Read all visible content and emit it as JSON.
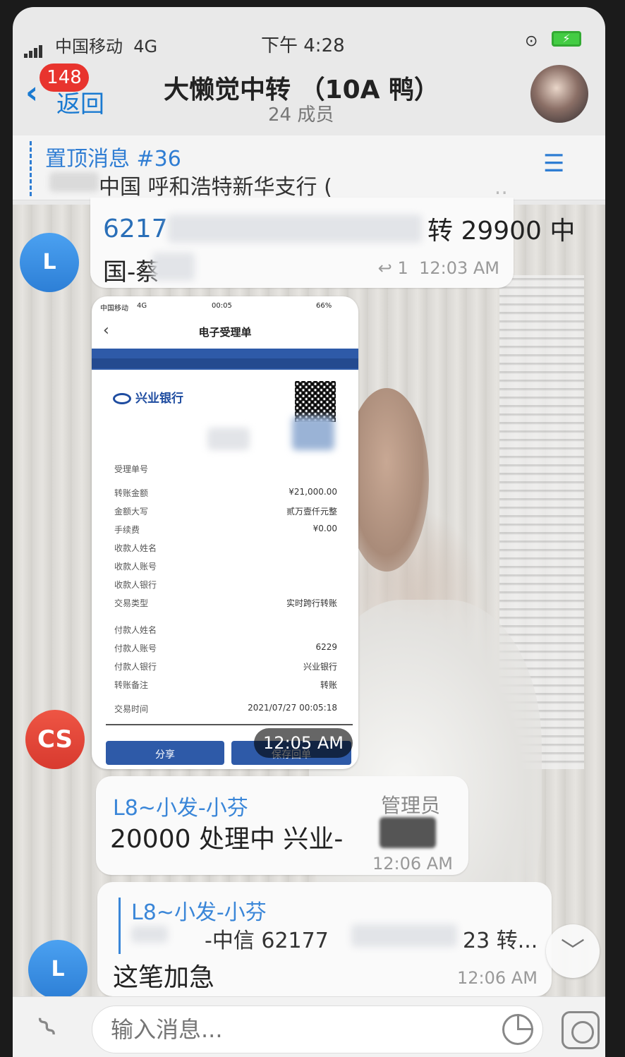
{
  "status_bar": {
    "carrier": "中国移动",
    "network": "4G",
    "time": "下午 4:28"
  },
  "header": {
    "unread_badge": "148",
    "back_label": "返回",
    "title": "大懒觉中转 （10A 鸭）",
    "members": "24 成员"
  },
  "pinned": {
    "title": "置顶消息 #36",
    "text": "中国 呼和浩特新华支行 (",
    "ellipsis": ".."
  },
  "messages": [
    {
      "avatar": "L",
      "line1": "6217",
      "line1_right": "转 29900 中",
      "line2": "国-蔡",
      "reply_count": "1",
      "time": "12:03 AM"
    },
    {
      "avatar": "CS",
      "time": "12:05 AM",
      "receipt": {
        "status_carrier": "中国移动",
        "status_net": "4G",
        "status_time": "00:05",
        "status_battery": "66%",
        "title": "电子受理单",
        "bank": "兴业银行",
        "rows": [
          {
            "k": "受理单号",
            "v": ""
          },
          {
            "k": "转账金额",
            "v": "¥21,000.00"
          },
          {
            "k": "金额大写",
            "v": "贰万壹仟元整"
          },
          {
            "k": "手续费",
            "v": "¥0.00"
          },
          {
            "k": "收款人姓名",
            "v": ""
          },
          {
            "k": "收款人账号",
            "v": ""
          },
          {
            "k": "收款人银行",
            "v": ""
          },
          {
            "k": "交易类型",
            "v": "实时跨行转账"
          },
          {
            "k": "付款人姓名",
            "v": ""
          },
          {
            "k": "付款人账号",
            "v": "6229"
          },
          {
            "k": "付款人银行",
            "v": "兴业银行"
          },
          {
            "k": "转账备注",
            "v": "转账"
          },
          {
            "k": "交易时间",
            "v": "2021/07/27 00:05:18"
          }
        ],
        "share": "分享",
        "save": "保存回单"
      }
    },
    {
      "sender": "L8~小发-小芬",
      "role": "管理员",
      "text": "20000  处理中  兴业-",
      "time": "12:06 AM"
    },
    {
      "avatar": "L",
      "reply_sender": "L8~小发-小芬",
      "reply_text": "-中信    62177",
      "reply_tail": "23 转...",
      "text": "这笔加急",
      "time": "12:06 AM"
    }
  ],
  "input": {
    "placeholder": "输入消息..."
  }
}
